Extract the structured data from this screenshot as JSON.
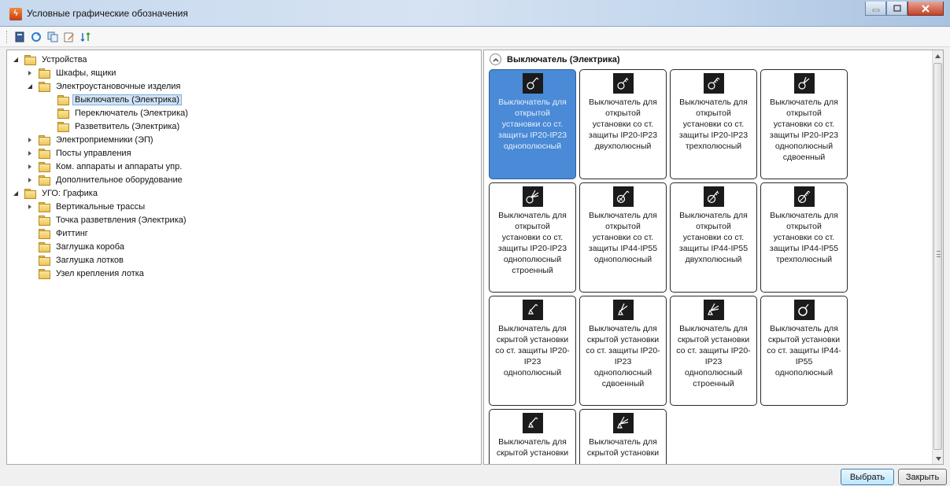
{
  "window": {
    "title": "Условные графические обозначения"
  },
  "toolbar": {
    "icons": [
      "book-icon",
      "refresh-icon",
      "copy-icon",
      "edit-icon",
      "sort-icon"
    ]
  },
  "tree": [
    {
      "label": "Устройства",
      "expanded": true
    },
    {
      "label": "Шкафы, ящики",
      "expanded": false
    },
    {
      "label": "Электроустановочные изделия",
      "expanded": true
    },
    {
      "label": "Выключатель (Электрика)",
      "selected": true
    },
    {
      "label": "Переключатель (Электрика)"
    },
    {
      "label": "Разветвитель (Электрика)"
    },
    {
      "label": "Электроприемники (ЭП)",
      "expanded": false
    },
    {
      "label": "Посты управления",
      "expanded": false
    },
    {
      "label": "Ком. аппараты и аппараты упр.",
      "expanded": false
    },
    {
      "label": "Дополнительное оборудование",
      "expanded": false
    },
    {
      "label": "УГО: Графика",
      "expanded": true
    },
    {
      "label": "Вертикальные трассы",
      "expanded": false
    },
    {
      "label": "Точка разветвления (Электрика)"
    },
    {
      "label": "Фиттинг"
    },
    {
      "label": "Заглушка короба"
    },
    {
      "label": "Заглушка лотков"
    },
    {
      "label": "Узел крепления лотка"
    }
  ],
  "group": {
    "title": "Выключатель (Электрика)"
  },
  "tiles": [
    {
      "caption": [
        "Выключатель для",
        "открытой",
        "установки со ст.",
        "защиты IP20-IP23",
        "однополюсный"
      ],
      "selected": true,
      "symbol": "switch-1p-open-icon"
    },
    {
      "caption": [
        "Выключатель для",
        "открытой",
        "установки со ст.",
        "защиты IP20-IP23",
        "двухполюсный"
      ],
      "symbol": "switch-2p-open-icon"
    },
    {
      "caption": [
        "Выключатель для",
        "открытой",
        "установки со ст.",
        "защиты IP20-IP23",
        "трехполюсный"
      ],
      "symbol": "switch-3p-open-icon"
    },
    {
      "caption": [
        "Выключатель для",
        "открытой",
        "установки со ст.",
        "защиты IP20-IP23",
        "однополюсный",
        "сдвоенный"
      ],
      "symbol": "switch-dual-open-icon"
    },
    {
      "caption": [
        "Выключатель для",
        "открытой",
        "установки со ст.",
        "защиты IP20-IP23",
        "однополюсный",
        "строенный"
      ],
      "symbol": "switch-triple-open-icon"
    },
    {
      "caption": [
        "Выключатель для",
        "открытой",
        "установки со ст.",
        "защиты IP44-IP55",
        "однополюсный"
      ],
      "symbol": "switch-1p-ip44-icon"
    },
    {
      "caption": [
        "Выключатель для",
        "открытой",
        "установки со ст.",
        "защиты IP44-IP55",
        "двухполюсный"
      ],
      "symbol": "switch-2p-ip44-icon"
    },
    {
      "caption": [
        "Выключатель для",
        "открытой",
        "установки со ст.",
        "защиты IP44-IP55",
        "трехполюсный"
      ],
      "symbol": "switch-3p-ip44-icon"
    },
    {
      "caption": [
        "Выключатель для",
        "скрытой установки",
        "со ст. защиты IP20-",
        "IP23",
        "однополюсный"
      ],
      "symbol": "switch-1p-hidden-icon"
    },
    {
      "caption": [
        "Выключатель для",
        "скрытой установки",
        "со ст. защиты IP20-",
        "IP23",
        "однополюсный",
        "сдвоенный"
      ],
      "symbol": "switch-dual-hidden-icon"
    },
    {
      "caption": [
        "Выключатель для",
        "скрытой установки",
        "со ст. защиты IP20-",
        "IP23",
        "однополюсный",
        "строенный"
      ],
      "symbol": "switch-triple-hidden-icon"
    },
    {
      "caption": [
        "Выключатель для",
        "скрытой установки",
        "со ст. защиты IP44-",
        "IP55",
        "однополюсный"
      ],
      "symbol": "switch-1p-hidden-ip44-icon"
    },
    {
      "caption": [
        "Выключатель для",
        "скрытой установки"
      ],
      "symbol": "switch-hidden-icon"
    },
    {
      "caption": [
        "Выключатель для",
        "скрытой установки"
      ],
      "symbol": "switch-hidden-multi-icon"
    }
  ],
  "buttons": {
    "select": "Выбрать",
    "close": "Закрыть"
  }
}
